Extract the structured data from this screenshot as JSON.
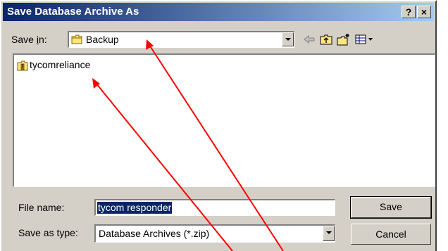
{
  "window": {
    "title": "Save Database Archive As",
    "help_label": "?",
    "close_label": "×"
  },
  "toolbar": {
    "save_in_label_prefix": "Save ",
    "save_in_label_underlined": "i",
    "save_in_label_suffix": "n:",
    "save_in_value": "Backup",
    "icons": [
      "back-arrow-icon",
      "up-folder-icon",
      "new-folder-icon",
      "views-menu-icon"
    ]
  },
  "file_list": {
    "items": [
      {
        "name": "tycomreliance",
        "icon": "locked-zip-folder-icon"
      }
    ]
  },
  "form": {
    "file_name_label": "File name:",
    "file_name_value": "tycom responder",
    "save_as_type_label": "Save as type:",
    "save_as_type_value": "Database Archives (*.zip)"
  },
  "buttons": {
    "save_label": "Save",
    "cancel_label": "Cancel"
  },
  "colors": {
    "title_start": "#0a246a",
    "title_end": "#a6caf0",
    "face": "#d4d0c8",
    "selection": "#0a246a",
    "annotation_arrow": "#ff0000"
  }
}
